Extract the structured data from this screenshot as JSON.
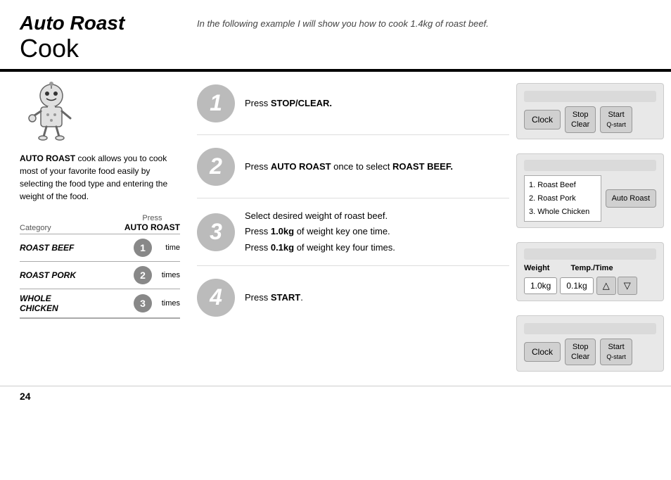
{
  "header": {
    "title_italic": "Auto Roast",
    "title_normal": "Cook",
    "subtitle": "In the following example I will show you how to cook 1.4kg of roast beef."
  },
  "left": {
    "description": {
      "bold": "AUTO ROAST",
      "rest": " cook allows you to cook most of your favorite food easily by selecting the food type and entering the weight of the food."
    },
    "category_header": {
      "category_label": "Category",
      "press_label": "Press",
      "press_bold": "AUTO ROAST"
    },
    "rows": [
      {
        "label": "ROAST BEEF",
        "badge": "1",
        "times": "time"
      },
      {
        "label": "ROAST PORK",
        "badge": "2",
        "times": "times"
      },
      {
        "label": "WHOLE\nCHICKEN",
        "badge": "3",
        "times": "times"
      }
    ]
  },
  "steps": [
    {
      "badge": "1",
      "text_parts": [
        {
          "type": "normal",
          "text": "Press "
        },
        {
          "type": "bold",
          "text": "STOP/CLEAR."
        }
      ]
    },
    {
      "badge": "2",
      "text_parts": [
        {
          "type": "normal",
          "text": "Press "
        },
        {
          "type": "bold",
          "text": "AUTO ROAST"
        },
        {
          "type": "normal",
          "text": " once to select "
        },
        {
          "type": "bold",
          "text": "ROAST BEEF."
        }
      ]
    },
    {
      "badge": "3",
      "lines": [
        "Select desired weight of roast beef.",
        [
          "normal",
          "Press "
        ],
        [
          "bold",
          "1.0kg"
        ],
        [
          "normal",
          " of weight key one time."
        ],
        [
          "normal",
          "Press "
        ],
        [
          "bold",
          "0.1kg"
        ],
        [
          "normal",
          " of weight key four times."
        ]
      ]
    },
    {
      "badge": "4",
      "text_parts": [
        {
          "type": "normal",
          "text": "Press "
        },
        {
          "type": "bold",
          "text": "START"
        },
        {
          "type": "normal",
          "text": "."
        }
      ]
    }
  ],
  "panels": [
    {
      "type": "buttons",
      "clock": "Clock",
      "stop_clear": "Stop\nClear",
      "start": "Start",
      "start_sub": "Q-start"
    },
    {
      "type": "menu",
      "items": [
        "1. Roast Beef",
        "2. Roast Pork",
        "3. Whole Chicken"
      ],
      "button": "Auto Roast"
    },
    {
      "type": "weight",
      "weight_label": "Weight",
      "temp_label": "Temp./Time",
      "val1": "1.0kg",
      "val2": "0.1kg"
    },
    {
      "type": "buttons",
      "clock": "Clock",
      "stop_clear": "Stop\nClear",
      "start": "Start",
      "start_sub": "Q-start"
    }
  ],
  "page_number": "24"
}
